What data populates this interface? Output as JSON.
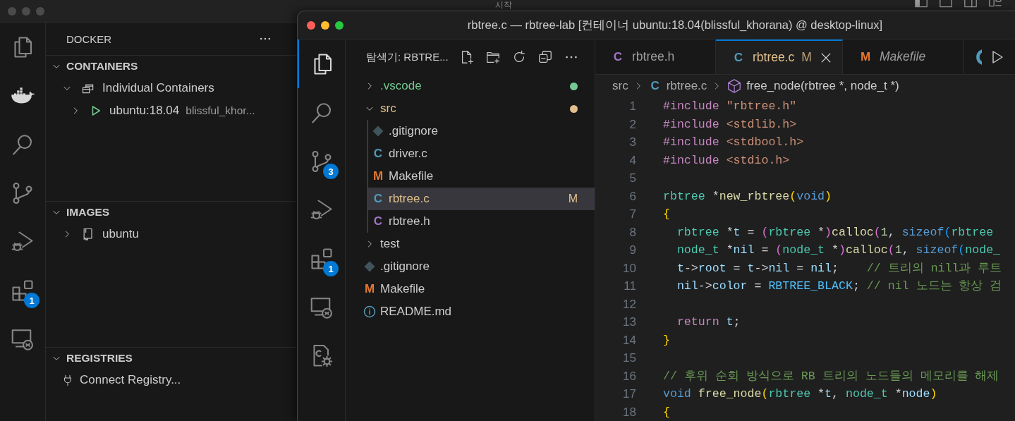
{
  "desktop": {
    "menu_title": "시작"
  },
  "back_window": {
    "activity_bar": [
      {
        "selected": false
      },
      {
        "selected": true
      },
      {
        "selected": false
      },
      {
        "selected": false
      },
      {
        "selected": false
      },
      {
        "selected": false,
        "badge": "1"
      },
      {
        "selected": false
      }
    ],
    "sidebar": {
      "title": "DOCKER",
      "sections": [
        {
          "title": "CONTAINERS",
          "expanded": true,
          "items": [
            {
              "label": "Individual Containers",
              "kind": "group",
              "expanded": true,
              "children": [
                {
                  "label": "ubuntu:18.04",
                  "description": "blissful_khor...",
                  "kind": "running",
                  "expanded": false
                }
              ]
            }
          ]
        },
        {
          "title": "IMAGES",
          "expanded": true,
          "items": [
            {
              "label": "ubuntu",
              "kind": "image",
              "expanded": false
            }
          ]
        },
        {
          "title": "REGISTRIES",
          "expanded": true,
          "items": [
            {
              "label": "Connect Registry...",
              "kind": "connect"
            }
          ]
        }
      ]
    }
  },
  "window": {
    "title": "rbtree.c — rbtree-lab [컨테이너 ubuntu:18.04(blissful_khorana) @ desktop-linux]",
    "activity_bar": [
      {
        "selected": true
      },
      {
        "selected": false
      },
      {
        "selected": false,
        "badge": "3"
      },
      {
        "selected": false
      },
      {
        "selected": false,
        "badge": "1"
      },
      {
        "selected": false
      },
      {
        "selected": false
      }
    ],
    "explorer": {
      "title": "탐색기: RBTRE...",
      "tree": [
        {
          "label": ".vscode",
          "kind": "folder",
          "expanded": false,
          "selected": false,
          "color": "#73c991"
        },
        {
          "label": "src",
          "kind": "folder",
          "expanded": true,
          "selected": false,
          "color": "#e2c08d",
          "children": [
            {
              "label": ".gitignore",
              "kind": "git",
              "selected": false
            },
            {
              "label": "driver.c",
              "kind": "c",
              "icon_text": "C",
              "selected": false
            },
            {
              "label": "Makefile",
              "kind": "make",
              "icon_text": "M",
              "selected": false
            },
            {
              "label": "rbtree.c",
              "kind": "c",
              "icon_text": "C",
              "selected": true,
              "color": "#e2c08d",
              "decoration": "M"
            },
            {
              "label": "rbtree.h",
              "kind": "h",
              "icon_text": "C",
              "selected": false
            }
          ]
        },
        {
          "label": "test",
          "kind": "folder",
          "expanded": false,
          "selected": false
        },
        {
          "label": ".gitignore",
          "kind": "git",
          "selected": false
        },
        {
          "label": "Makefile",
          "kind": "make",
          "icon_text": "M",
          "selected": false
        },
        {
          "label": "README.md",
          "kind": "info",
          "selected": false
        }
      ]
    },
    "tabs": [
      {
        "label": "rbtree.h",
        "kind": "h",
        "icon_text": "C",
        "selected": false,
        "preview": false
      },
      {
        "label": "rbtree.c",
        "kind": "c",
        "icon_text": "C",
        "selected": true,
        "preview": false,
        "color": "#e2c08d",
        "decoration": "M"
      },
      {
        "label": "Makefile",
        "kind": "make",
        "icon_text": "M",
        "selected": false,
        "preview": true
      }
    ],
    "breadcrumb": [
      {
        "label": "src",
        "kind": "folder"
      },
      {
        "label": "rbtree.c",
        "kind": "c",
        "icon_text": "C"
      },
      {
        "label": "free_node(rbtree *, node_t *)",
        "kind": "symbol"
      }
    ],
    "code": [
      {
        "number": "1",
        "tokens": [
          {
            "text": "#include",
            "kind": "pp"
          },
          {
            "text": " \"rbtree.h\"",
            "kind": "str"
          }
        ]
      },
      {
        "number": "2",
        "tokens": [
          {
            "text": "#include",
            "kind": "pp"
          },
          {
            "text": " <stdlib.h>",
            "kind": "str"
          }
        ]
      },
      {
        "number": "3",
        "tokens": [
          {
            "text": "#include",
            "kind": "pp"
          },
          {
            "text": " <stdbool.h>",
            "kind": "str"
          }
        ]
      },
      {
        "number": "4",
        "tokens": [
          {
            "text": "#include",
            "kind": "pp"
          },
          {
            "text": " <stdio.h>",
            "kind": "str"
          }
        ]
      },
      {
        "number": "5"
      },
      {
        "number": "6",
        "tokens": [
          {
            "text": "rbtree",
            "kind": "type"
          },
          {
            "text": " *",
            "kind": "p"
          },
          {
            "text": "new_rbtree",
            "kind": "fn"
          },
          {
            "text": "(",
            "kind": "b1"
          },
          {
            "text": "void",
            "kind": "kw"
          },
          {
            "text": ")",
            "kind": "b1"
          }
        ]
      },
      {
        "number": "7",
        "tokens": [
          {
            "text": "{",
            "kind": "b1"
          }
        ]
      },
      {
        "number": "8",
        "tokens": [
          {
            "text": "  rbtree",
            "kind": "type"
          },
          {
            "text": " *",
            "kind": "p"
          },
          {
            "text": "t",
            "kind": "var"
          },
          {
            "text": " = ",
            "kind": "p"
          },
          {
            "text": "(",
            "kind": "b2"
          },
          {
            "text": "rbtree",
            "kind": "type"
          },
          {
            "text": " *",
            "kind": "p"
          },
          {
            "text": ")",
            "kind": "b2"
          },
          {
            "text": "calloc",
            "kind": "fn"
          },
          {
            "text": "(",
            "kind": "b2"
          },
          {
            "text": "1",
            "kind": "num"
          },
          {
            "text": ", ",
            "kind": "p"
          },
          {
            "text": "sizeof",
            "kind": "kw"
          },
          {
            "text": "(",
            "kind": "b3"
          },
          {
            "text": "rbtree",
            "kind": "type"
          }
        ]
      },
      {
        "number": "9",
        "tokens": [
          {
            "text": "  node_t",
            "kind": "type"
          },
          {
            "text": " *",
            "kind": "p"
          },
          {
            "text": "nil",
            "kind": "var"
          },
          {
            "text": " = ",
            "kind": "p"
          },
          {
            "text": "(",
            "kind": "b2"
          },
          {
            "text": "node_t",
            "kind": "type"
          },
          {
            "text": " *",
            "kind": "p"
          },
          {
            "text": ")",
            "kind": "b2"
          },
          {
            "text": "calloc",
            "kind": "fn"
          },
          {
            "text": "(",
            "kind": "b2"
          },
          {
            "text": "1",
            "kind": "num"
          },
          {
            "text": ", ",
            "kind": "p"
          },
          {
            "text": "sizeof",
            "kind": "kw"
          },
          {
            "text": "(",
            "kind": "b3"
          },
          {
            "text": "node_",
            "kind": "type"
          }
        ]
      },
      {
        "number": "10",
        "tokens": [
          {
            "text": "  t",
            "kind": "var"
          },
          {
            "text": "->",
            "kind": "p"
          },
          {
            "text": "root",
            "kind": "var"
          },
          {
            "text": " = ",
            "kind": "p"
          },
          {
            "text": "t",
            "kind": "var"
          },
          {
            "text": "->",
            "kind": "p"
          },
          {
            "text": "nil",
            "kind": "var"
          },
          {
            "text": " = ",
            "kind": "p"
          },
          {
            "text": "nil",
            "kind": "var"
          },
          {
            "text": ";",
            "kind": "p"
          },
          {
            "text": "    // 트리의 nill과 루트",
            "kind": "cmt"
          }
        ]
      },
      {
        "number": "11",
        "tokens": [
          {
            "text": "  nil",
            "kind": "var"
          },
          {
            "text": "->",
            "kind": "p"
          },
          {
            "text": "color",
            "kind": "var"
          },
          {
            "text": " = ",
            "kind": "p"
          },
          {
            "text": "RBTREE_BLACK",
            "kind": "const"
          },
          {
            "text": ";",
            "kind": "p"
          },
          {
            "text": " // nil 노드는 항상 검",
            "kind": "cmt"
          }
        ]
      },
      {
        "number": "12"
      },
      {
        "number": "13",
        "tokens": [
          {
            "text": "  return",
            "kind": "ctrl"
          },
          {
            "text": " t",
            "kind": "var"
          },
          {
            "text": ";",
            "kind": "p"
          }
        ]
      },
      {
        "number": "14",
        "tokens": [
          {
            "text": "}",
            "kind": "b1"
          }
        ]
      },
      {
        "number": "15"
      },
      {
        "number": "16",
        "tokens": [
          {
            "text": "// 후위 순회 방식으로 RB 트리의 노드들의 메모리를 해제",
            "kind": "cmt"
          }
        ]
      },
      {
        "number": "17",
        "tokens": [
          {
            "text": "void",
            "kind": "kw"
          },
          {
            "text": " free_node",
            "kind": "fn"
          },
          {
            "text": "(",
            "kind": "b1"
          },
          {
            "text": "rbtree",
            "kind": "type"
          },
          {
            "text": " *",
            "kind": "p"
          },
          {
            "text": "t",
            "kind": "var"
          },
          {
            "text": ", ",
            "kind": "p"
          },
          {
            "text": "node_t",
            "kind": "type"
          },
          {
            "text": " *",
            "kind": "p"
          },
          {
            "text": "node",
            "kind": "var"
          },
          {
            "text": ")",
            "kind": "b1"
          }
        ]
      },
      {
        "number": "18",
        "tokens": [
          {
            "text": "{",
            "kind": "b1"
          }
        ]
      }
    ]
  }
}
